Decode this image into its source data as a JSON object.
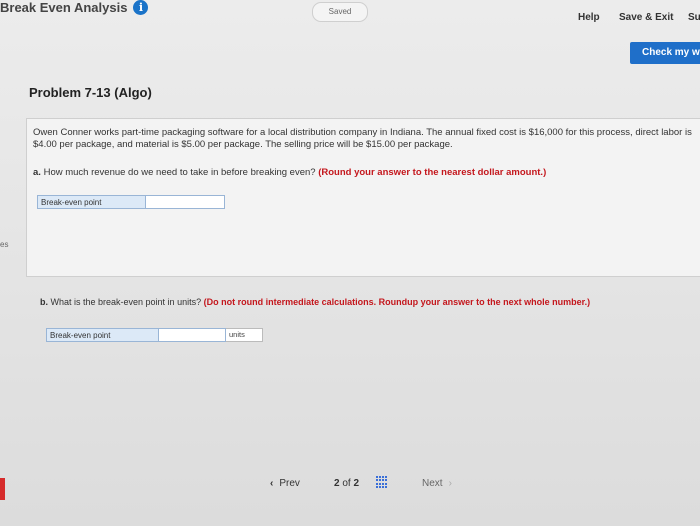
{
  "header": {
    "title": "Break Even Analysis",
    "saved_label": "Saved",
    "help_label": "Help",
    "save_exit_label": "Save & Exit",
    "submit_label": "Su",
    "check_label": "Check my wo",
    "side_label": "es"
  },
  "problem": {
    "title": "Problem 7-13 (Algo)",
    "text": "Owen Conner works part-time packaging software for a local distribution company in Indiana. The annual fixed cost is $16,000 for this process, direct labor is $4.00 per package, and material is $5.00 per package. The selling price will be $15.00 per package.",
    "part_a": {
      "prefix": "a.",
      "question": " How much revenue do we need to take in before breaking even? ",
      "instruction": "(Round your answer to the nearest dollar amount.)",
      "answer_label": "Break-even point",
      "answer_value": ""
    },
    "part_b": {
      "prefix": "b.",
      "question": " What is the break-even point in units? ",
      "instruction": "(Do not round intermediate calculations. Roundup your answer to the next whole number.)",
      "answer_label": "Break-even point",
      "answer_value": "",
      "unit": "units"
    }
  },
  "footer": {
    "prev_label": "Prev",
    "page_current": "2",
    "page_of": "of",
    "page_total": "2",
    "next_label": "Next"
  },
  "colors": {
    "accent": "#1f6fc9",
    "instruction_red": "#c4171d"
  }
}
